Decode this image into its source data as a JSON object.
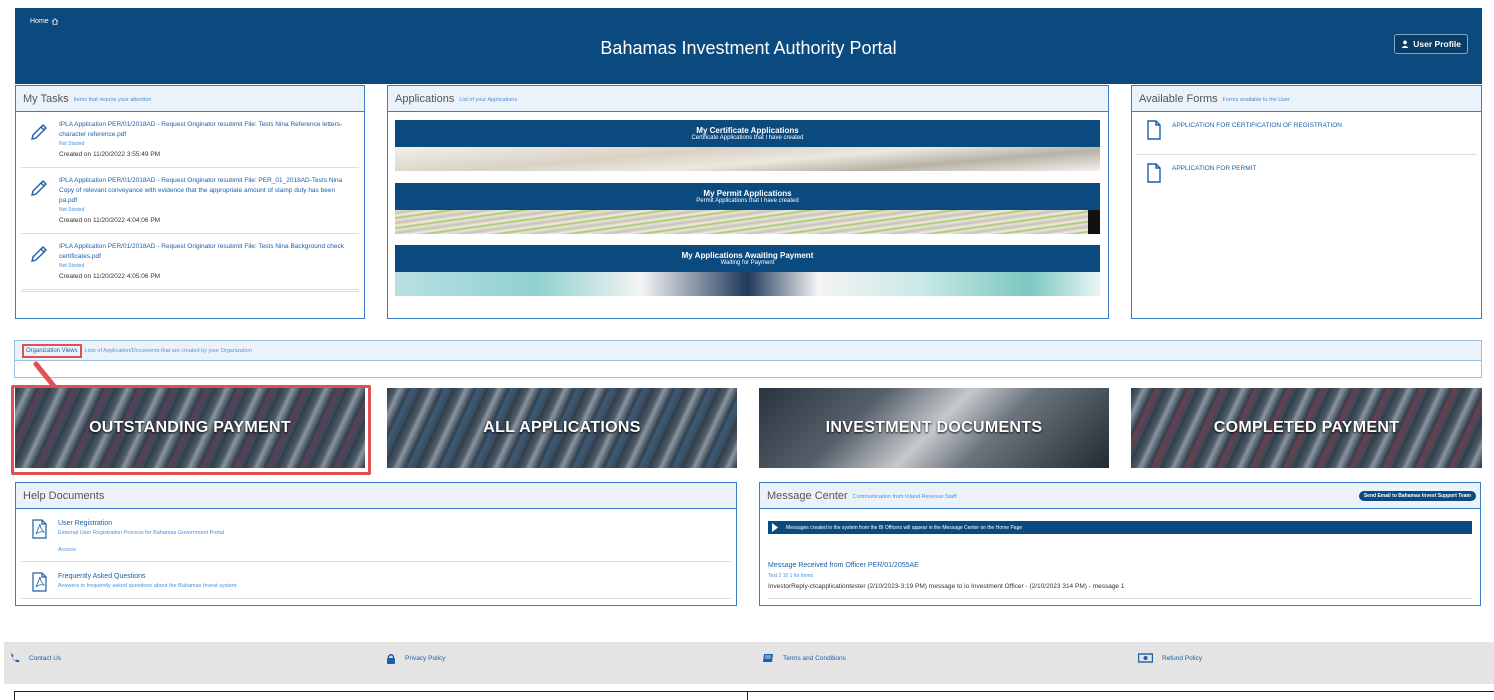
{
  "header": {
    "home_label": "Home",
    "title": "Bahamas Investment Authority Portal",
    "profile_button": "User Profile"
  },
  "my_tasks": {
    "title": "My Tasks",
    "subtitle": "Items that require your attention",
    "items": [
      {
        "text": "IPLA Application PER/01/2018AD -  Request Originator resubmit  File: Tests Nina Reference letters- character reference.pdf",
        "status": "Not Started",
        "created": "Created on 11/20/2022 3:55:49 PM"
      },
      {
        "text": "IPLA Application PER/01/2018AD -  Request Originator resubmit  File: PER_01_2018AD-Tests Nina Copy of relevant conveyance with evidence that the appropriate amount of stamp duty has been pa.pdf",
        "status": "Not Started",
        "created": "Created on 11/20/2022 4:04:06 PM"
      },
      {
        "text": "IPLA Application PER/01/2018AD -  Request Originator resubmit  File: Tests Nina Background check certificates.pdf",
        "status": "Not Started",
        "created": "Created on 11/20/2022 4:05:06 PM"
      }
    ]
  },
  "applications": {
    "title": "Applications",
    "subtitle": "List of your Applications",
    "tiles": [
      {
        "title": "My Certificate Applications",
        "subtitle": "Certificate Applications that I have created"
      },
      {
        "title": "My Permit Applications",
        "subtitle": "Permit Applications that I have created"
      },
      {
        "title": "My Applications Awaiting Payment",
        "subtitle": "Waiting for Payment"
      }
    ]
  },
  "available_forms": {
    "title": "Available Forms",
    "subtitle": "Forms available to the User",
    "items": [
      "APPLICATION FOR CERTIFICATION OF REGISTRATION",
      "APPLICATION FOR PERMIT"
    ]
  },
  "org_views": {
    "title": "Organization Views",
    "subtitle": "Lists of Application/Documents that are created by your Organization"
  },
  "tiles": [
    "OUTSTANDING PAYMENT",
    "ALL APPLICATIONS",
    "INVESTMENT DOCUMENTS",
    "COMPLETED PAYMENT"
  ],
  "help_documents": {
    "title": "Help Documents",
    "items": [
      {
        "title": "User Registration",
        "desc": "External User Registration Process for Bahamas Government Portal",
        "extra": "Access"
      },
      {
        "title": "Frequently Asked Questions",
        "desc": "Answers to frequently asked questions about the Bahamas Invest system",
        "extra": ""
      }
    ]
  },
  "message_center": {
    "title": "Message Center",
    "subtitle": "Communication from Inland Revenue Staff",
    "email_button": "Send Email to Bahamas Invest Support Team",
    "banner": "Messages created in the system from the BI Officers will appear in the Message Center on the Home Page",
    "message": {
      "title": "Message Received from Officer PER/01/2055AE",
      "meta": "Test 2 10 1 for items",
      "text": "InvestorReply-ctcapplicationtester (2/10/2023-3:19 PM) message to io Investment Officer - (2/10/2023 314 PM) - message 1"
    }
  },
  "footer": {
    "contact": "Contact Us",
    "privacy": "Privacy Policy",
    "terms": "Terms and Conditions",
    "refund": "Refund Policy"
  },
  "colors": {
    "brand": "#0b4a7e",
    "link": "#1d5fa7",
    "highlight": "#e05050"
  }
}
